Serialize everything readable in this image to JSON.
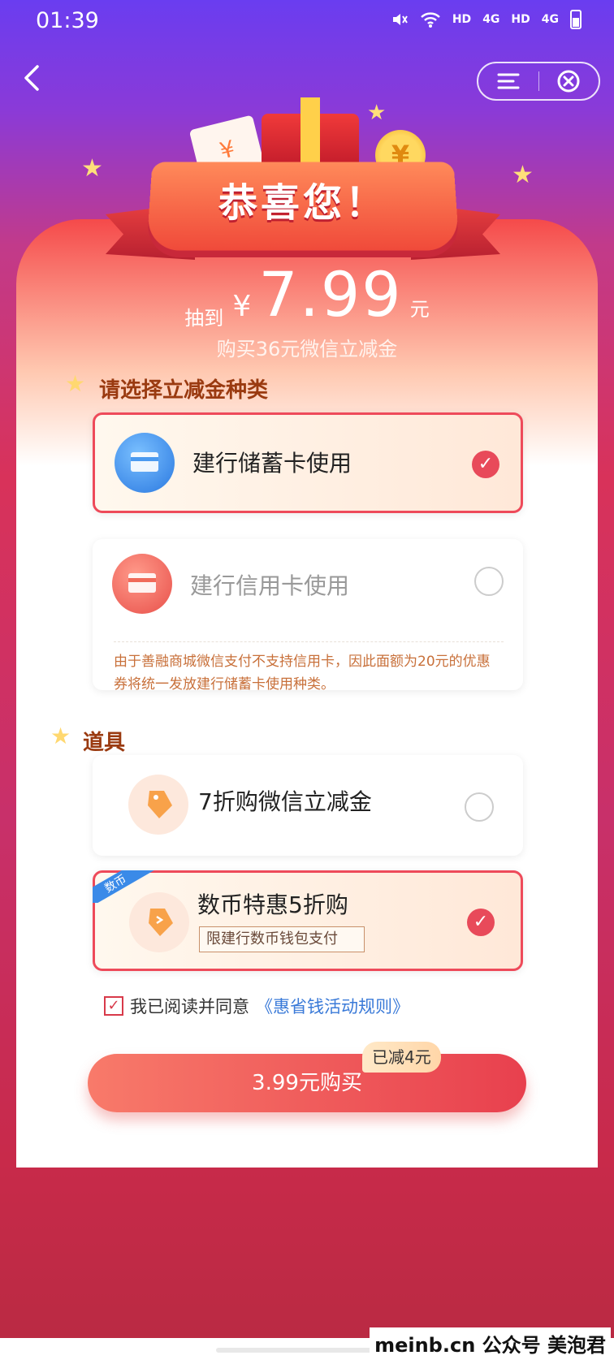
{
  "status": {
    "time": "01:39",
    "net1": "HD",
    "net2": "4G",
    "net3": "HD",
    "net4": "4G"
  },
  "header": {
    "back_icon": "chevron-left-icon",
    "menu_icon": "menu-icon",
    "close_icon": "close-circle-icon"
  },
  "banner": {
    "title": "恭喜您！"
  },
  "prize": {
    "pre": "抽到",
    "currency": "¥",
    "amount": "7.99",
    "unit": "元",
    "subtitle": "购买36元微信立减金"
  },
  "select_section": {
    "title": "请选择立减金种类"
  },
  "options": [
    {
      "label": "建行储蓄卡使用",
      "selected": true
    },
    {
      "label": "建行信用卡使用",
      "selected": false,
      "note": "由于善融商城微信支付不支持信用卡，因此面额为20元的优惠券将统一发放建行储蓄卡使用种类。"
    }
  ],
  "tools_section": {
    "title": "道具"
  },
  "tools": [
    {
      "label": "7折购微信立减金",
      "selected": false
    },
    {
      "label": "数币特惠5折购",
      "selected": true,
      "corner_tag": "数币",
      "limit": "限建行数币钱包支付"
    }
  ],
  "agreement": {
    "text": "我已阅读并同意",
    "link": "《惠省钱活动规则》",
    "checked": true
  },
  "buy": {
    "label": "3.99元购买",
    "badge": "已减4元"
  },
  "watermark": "meinb.cn  公众号 美泡君",
  "colors": {
    "accent": "#e84a5a",
    "link": "#3a7ad8",
    "section": "#9a3a10"
  }
}
